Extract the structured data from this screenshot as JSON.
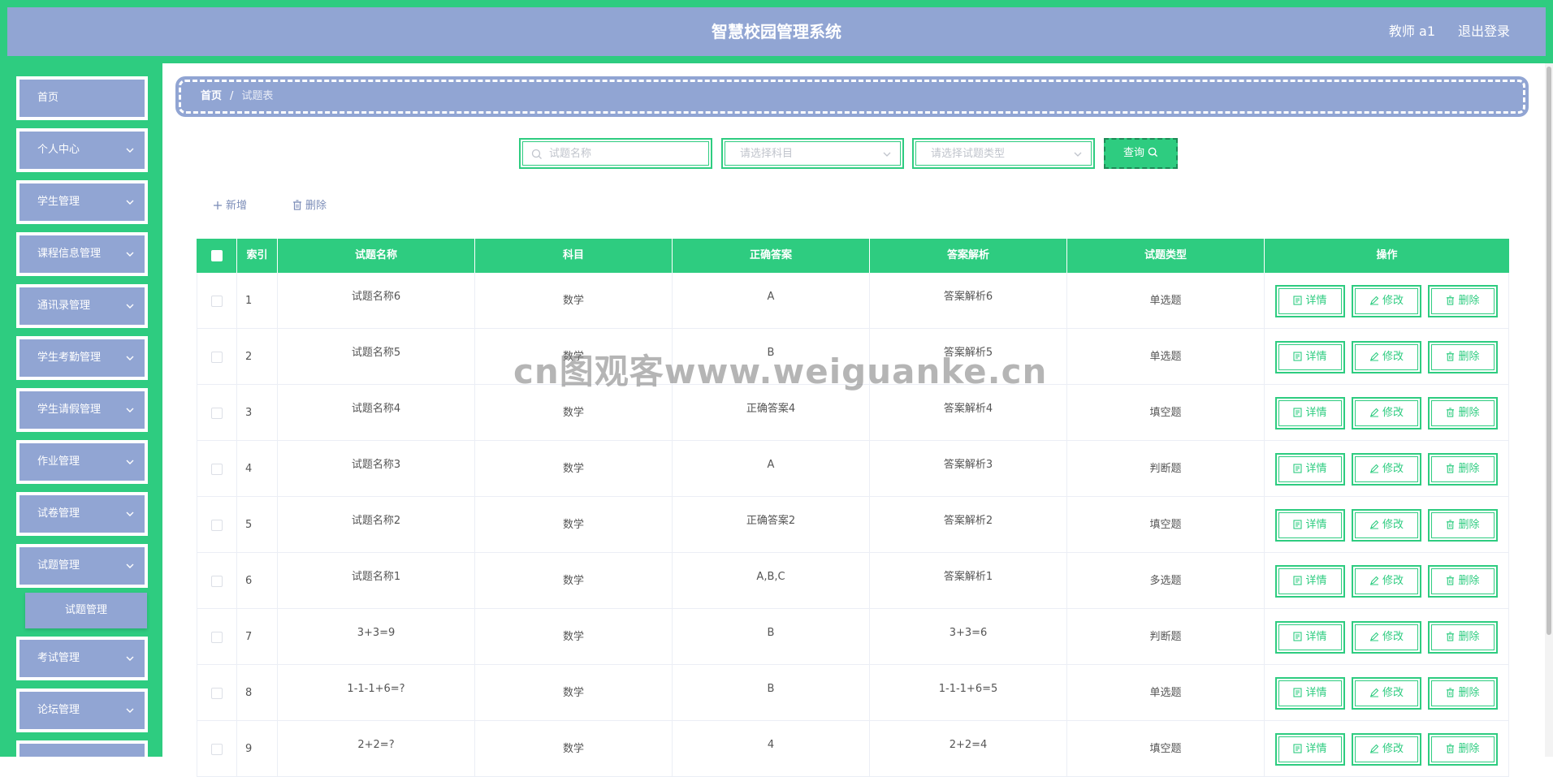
{
  "header": {
    "title": "智慧校园管理系统",
    "user": "教师 a1",
    "logout": "退出登录"
  },
  "sidebar": {
    "items": [
      {
        "label": "首页",
        "has_children": false
      },
      {
        "label": "个人中心",
        "has_children": true
      },
      {
        "label": "学生管理",
        "has_children": true
      },
      {
        "label": "课程信息管理",
        "has_children": true
      },
      {
        "label": "通讯录管理",
        "has_children": true
      },
      {
        "label": "学生考勤管理",
        "has_children": true
      },
      {
        "label": "学生请假管理",
        "has_children": true
      },
      {
        "label": "作业管理",
        "has_children": true
      },
      {
        "label": "试卷管理",
        "has_children": true
      },
      {
        "label": "试题管理",
        "has_children": true
      },
      {
        "label": "考试管理",
        "has_children": true
      },
      {
        "label": "论坛管理",
        "has_children": true
      }
    ],
    "submenu": {
      "label": "试题管理"
    }
  },
  "breadcrumb": {
    "home": "首页",
    "separator": "/",
    "current": "试题表"
  },
  "search": {
    "name_placeholder": "试题名称",
    "subject_placeholder": "请选择科目",
    "type_placeholder": "请选择试题类型",
    "query_label": "查询"
  },
  "actions": {
    "add_label": "新增",
    "delete_label": "删除"
  },
  "table": {
    "headers": {
      "index": "索引",
      "name": "试题名称",
      "subject": "科目",
      "answer": "正确答案",
      "analysis": "答案解析",
      "type": "试题类型",
      "ops": "操作"
    },
    "ops": {
      "detail": "详情",
      "edit": "修改",
      "delete": "删除"
    },
    "rows": [
      {
        "index": "1",
        "name": "试题名称6",
        "subject": "数学",
        "answer": "A",
        "analysis": "答案解析6",
        "type": "单选题"
      },
      {
        "index": "2",
        "name": "试题名称5",
        "subject": "数学",
        "answer": "B",
        "analysis": "答案解析5",
        "type": "单选题"
      },
      {
        "index": "3",
        "name": "试题名称4",
        "subject": "数学",
        "answer": "正确答案4",
        "analysis": "答案解析4",
        "type": "填空题"
      },
      {
        "index": "4",
        "name": "试题名称3",
        "subject": "数学",
        "answer": "A",
        "analysis": "答案解析3",
        "type": "判断题"
      },
      {
        "index": "5",
        "name": "试题名称2",
        "subject": "数学",
        "answer": "正确答案2",
        "analysis": "答案解析2",
        "type": "填空题"
      },
      {
        "index": "6",
        "name": "试题名称1",
        "subject": "数学",
        "answer": "A,B,C",
        "analysis": "答案解析1",
        "type": "多选题"
      },
      {
        "index": "7",
        "name": "3+3=9",
        "subject": "数学",
        "answer": "B",
        "analysis": "3+3=6",
        "type": "判断题"
      },
      {
        "index": "8",
        "name": "1-1-1+6=?",
        "subject": "数学",
        "answer": "B",
        "analysis": "1-1-1+6=5",
        "type": "单选题"
      },
      {
        "index": "9",
        "name": "2+2=?",
        "subject": "数学",
        "answer": "4",
        "analysis": "2+2=4",
        "type": "填空题"
      }
    ]
  },
  "watermark": "cn图观客www.weiguanke.cn",
  "colors": {
    "primary": "#2ecc80",
    "secondary": "#91a5d3"
  }
}
